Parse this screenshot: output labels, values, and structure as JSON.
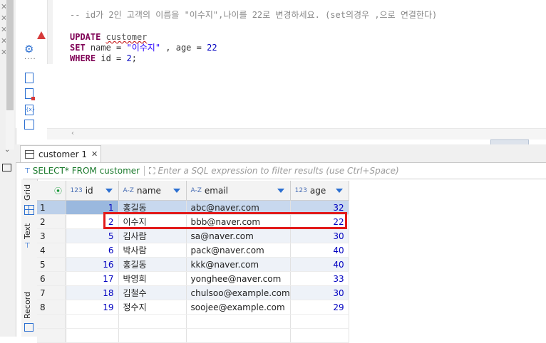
{
  "editor": {
    "comment_line": "-- id가 2인 고객의 이름을 \"이수지\",나이를 22로 변경하세요. (set의경우 ,으로 연결한다)",
    "line1_kw": "UPDATE",
    "line1_table": "customer",
    "line2_kw": "SET",
    "line2_rest_a": " name = ",
    "line2_str": "\"이수지\"",
    "line2_rest_b": " , age = ",
    "line2_num": "22",
    "line3_kw": "WHERE",
    "line3_rest": " id = ",
    "line3_num": "2",
    "line3_end": ";"
  },
  "results_tab": {
    "label": "customer 1",
    "close_glyph": "✕"
  },
  "filter": {
    "sql": "SELECT* FROM customer",
    "placeholder": "Enter a SQL expression to filter results (use Ctrl+Space)"
  },
  "side_tabs": {
    "grid": "Grid",
    "text": "Text",
    "record": "Record"
  },
  "grid": {
    "columns": [
      {
        "type": "123",
        "name": "id"
      },
      {
        "type": "A-Z",
        "name": "name"
      },
      {
        "type": "A-Z",
        "name": "email"
      },
      {
        "type": "123",
        "name": "age"
      }
    ],
    "rows": [
      {
        "n": "1",
        "id": "1",
        "name": "홍길동",
        "email": "abc@naver.com",
        "age": "32"
      },
      {
        "n": "2",
        "id": "2",
        "name": "이수지",
        "email": "bbb@naver.com",
        "age": "22"
      },
      {
        "n": "3",
        "id": "5",
        "name": "김사람",
        "email": "sa@naver.com",
        "age": "30"
      },
      {
        "n": "4",
        "id": "6",
        "name": "박사람",
        "email": "pack@naver.com",
        "age": "40"
      },
      {
        "n": "5",
        "id": "16",
        "name": "홍길동",
        "email": "kkk@naver.com",
        "age": "40"
      },
      {
        "n": "6",
        "id": "17",
        "name": "박영희",
        "email": "yonghee@naver.com",
        "age": "33"
      },
      {
        "n": "7",
        "id": "18",
        "name": "김철수",
        "email": "chulsoo@example.com",
        "age": "30"
      },
      {
        "n": "8",
        "id": "19",
        "name": "정수지",
        "email": "soojee@example.com",
        "age": "29"
      }
    ]
  },
  "colors": {
    "keyword": "#7f0055",
    "highlight_box": "#e21a1a",
    "header_arrow": "#2b6fd1"
  }
}
